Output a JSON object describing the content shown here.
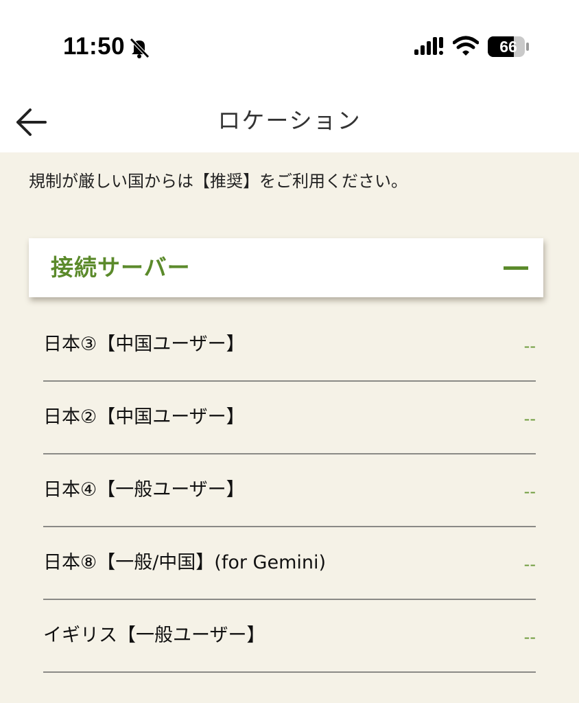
{
  "status_bar": {
    "time": "11:50",
    "battery": "66",
    "icons": [
      "bell-slash-icon",
      "signal-icon",
      "wifi-icon",
      "battery-icon"
    ]
  },
  "nav": {
    "title": "ロケーション",
    "back_icon": "arrow-left-icon"
  },
  "notice": "規制が厳しい国からは【推奨】をご利用ください。",
  "section": {
    "title": "接続サーバー",
    "toggle_icon": "minus-icon"
  },
  "servers": [
    {
      "name": "日本③【中国ユーザー】",
      "ping": "--"
    },
    {
      "name": "日本②【中国ユーザー】",
      "ping": "--"
    },
    {
      "name": "日本④【一般ユーザー】",
      "ping": "--"
    },
    {
      "name": "日本⑧【一般/中国】(for Gemini)",
      "ping": "--"
    },
    {
      "name": "イギリス【一般ユーザー】",
      "ping": "--"
    }
  ],
  "colors": {
    "accent": "#5b8a2b",
    "background": "#f5f2e7",
    "ping": "#6b9a3a"
  }
}
